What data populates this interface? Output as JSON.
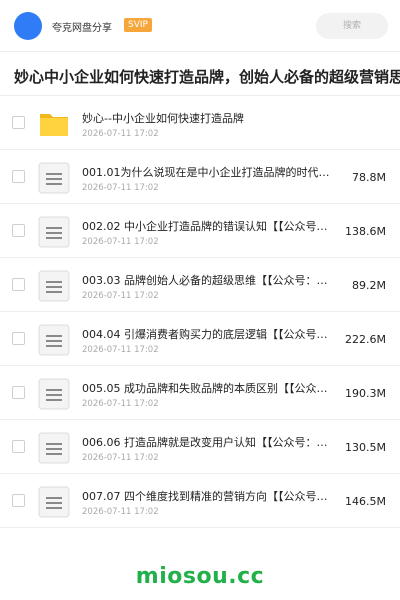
{
  "header": {
    "owner_name": "夸克网盘分享",
    "badge": "SVIP",
    "search_placeholder": "搜索"
  },
  "share": {
    "title": "妙心中小企业如何快速打造品牌，创始人必备的超级营销思"
  },
  "files": [
    {
      "name": "妙心--中小企业如何快速打造品牌",
      "date": "2026-07-11 17:02",
      "size": "",
      "type": "folder"
    },
    {
      "name": "001.01为什么说现在是中小企业打造品牌的时代【…",
      "date": "2026-07-11 17:02",
      "size": "78.8M",
      "type": "doc"
    },
    {
      "name": "002.02 中小企业打造品牌的错误认知【【公众号…",
      "date": "2026-07-11 17:02",
      "size": "138.6M",
      "type": "doc"
    },
    {
      "name": "003.03 品牌创始人必备的超级思维【【公众号：…",
      "date": "2026-07-11 17:02",
      "size": "89.2M",
      "type": "doc"
    },
    {
      "name": "004.04 引爆消费者购买力的底层逻辑【【公众号…",
      "date": "2026-07-11 17:02",
      "size": "222.6M",
      "type": "doc"
    },
    {
      "name": "005.05 成功品牌和失败品牌的本质区别【【公众…",
      "date": "2026-07-11 17:02",
      "size": "190.3M",
      "type": "doc"
    },
    {
      "name": "006.06 打造品牌就是改变用户认知【【公众号：…",
      "date": "2026-07-11 17:02",
      "size": "130.5M",
      "type": "doc"
    },
    {
      "name": "007.07 四个维度找到精准的营销方向【【公众号…",
      "date": "2026-07-11 17:02",
      "size": "146.5M",
      "type": "doc"
    }
  ],
  "watermark": "miosou.cc"
}
